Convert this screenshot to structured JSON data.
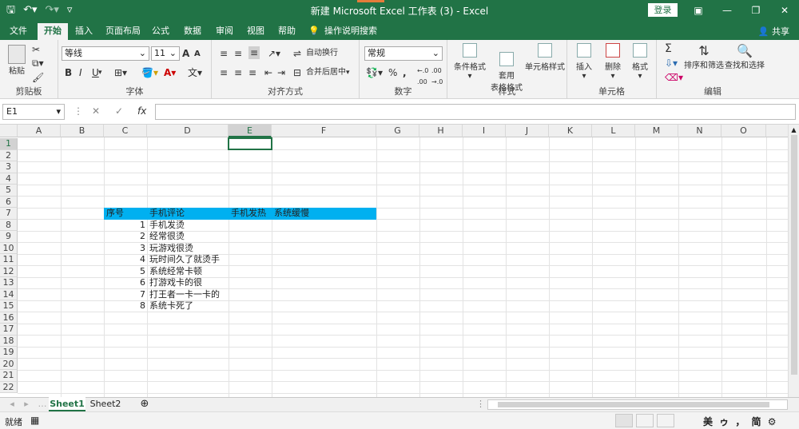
{
  "titlebar": {
    "title": "新建 Microsoft Excel 工作表 (3)  -  Excel",
    "login": "登录",
    "save_icon": "save-icon",
    "undo_icon": "undo-icon",
    "redo_icon": "redo-icon"
  },
  "tabs": [
    "文件",
    "开始",
    "插入",
    "页面布局",
    "公式",
    "数据",
    "审阅",
    "视图",
    "帮助",
    "操作说明搜索"
  ],
  "share": "共享",
  "ribbon": {
    "clipboard": {
      "label": "剪贴板",
      "paste": "粘贴"
    },
    "font": {
      "label": "字体",
      "name": "等线",
      "size": "11",
      "grow": "A",
      "shrink": "A",
      "bold": "B",
      "italic": "I",
      "underline": "U"
    },
    "align": {
      "label": "对齐方式",
      "wrap": "自动换行",
      "merge": "合并后居中"
    },
    "number": {
      "label": "数字",
      "format": "常规",
      "percent": "%",
      "comma": ","
    },
    "styles": {
      "label": "样式",
      "cond": "条件格式",
      "table": "套用\n表格格式",
      "cell": "单元格样式"
    },
    "cells": {
      "label": "单元格",
      "insert": "插入",
      "delete": "删除",
      "format": "格式"
    },
    "editing": {
      "label": "编辑",
      "sort": "排序和筛选",
      "find": "查找和选择",
      "sum": "Σ"
    }
  },
  "formula_bar": {
    "namebox": "E1",
    "fx": "fx",
    "cancel": "✕",
    "confirm": "✓"
  },
  "columns": [
    "A",
    "B",
    "C",
    "D",
    "E",
    "F",
    "G",
    "H",
    "I",
    "J",
    "K",
    "L",
    "M",
    "N",
    "O"
  ],
  "rows": [
    "1",
    "2",
    "3",
    "4",
    "5",
    "6",
    "7",
    "8",
    "9",
    "10",
    "11",
    "12",
    "13",
    "14",
    "15",
    "16",
    "17",
    "18",
    "19",
    "20",
    "21",
    "22"
  ],
  "cells": {
    "header": {
      "c": "序号",
      "d": "手机评论",
      "e": "手机发热",
      "f": "系统缓慢"
    },
    "data": [
      {
        "c": "1",
        "d": "手机发烫"
      },
      {
        "c": "2",
        "d": "经常很烫"
      },
      {
        "c": "3",
        "d": "玩游戏很烫"
      },
      {
        "c": "4",
        "d": "玩时间久了就烫手"
      },
      {
        "c": "5",
        "d": "系统经常卡顿"
      },
      {
        "c": "6",
        "d": "打游戏卡的很"
      },
      {
        "c": "7",
        "d": "打王者一卡一卡的"
      },
      {
        "c": "8",
        "d": "系统卡死了"
      }
    ]
  },
  "sheets": [
    "Sheet1",
    "Sheet2"
  ],
  "status": {
    "ready": "就绪",
    "ime": "美 ゥ ， 简 ⚙"
  },
  "colors": {
    "brand": "#217346",
    "header_fill": "#00b0f0"
  }
}
